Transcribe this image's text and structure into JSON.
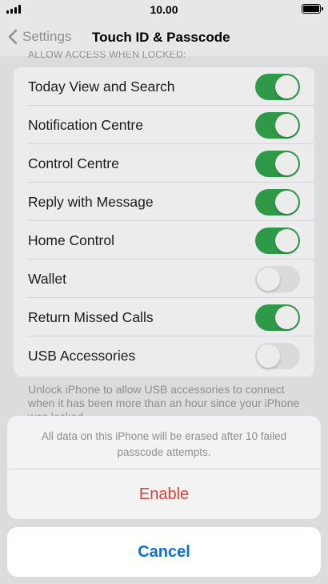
{
  "status_bar": {
    "time": "10.00"
  },
  "nav": {
    "back_label": "Settings",
    "title": "Touch ID & Passcode"
  },
  "section_header": "ALLOW ACCESS WHEN LOCKED:",
  "settings": [
    {
      "label": "Today View and Search",
      "on": true
    },
    {
      "label": "Notification Centre",
      "on": true
    },
    {
      "label": "Control Centre",
      "on": true
    },
    {
      "label": "Reply with Message",
      "on": true
    },
    {
      "label": "Home Control",
      "on": true
    },
    {
      "label": "Wallet",
      "on": false
    },
    {
      "label": "Return Missed Calls",
      "on": true
    },
    {
      "label": "USB Accessories",
      "on": false
    }
  ],
  "footer_note": "Unlock iPhone to allow USB accessories to connect when it has been more than an hour since your iPhone was locked.",
  "action_sheet": {
    "message": "All data on this iPhone will be erased after 10 failed passcode attempts.",
    "enable_label": "Enable",
    "cancel_label": "Cancel"
  },
  "colors": {
    "toggle_on": "#2e9a47",
    "destructive": "#e0403a",
    "action": "#0a6fd8"
  }
}
